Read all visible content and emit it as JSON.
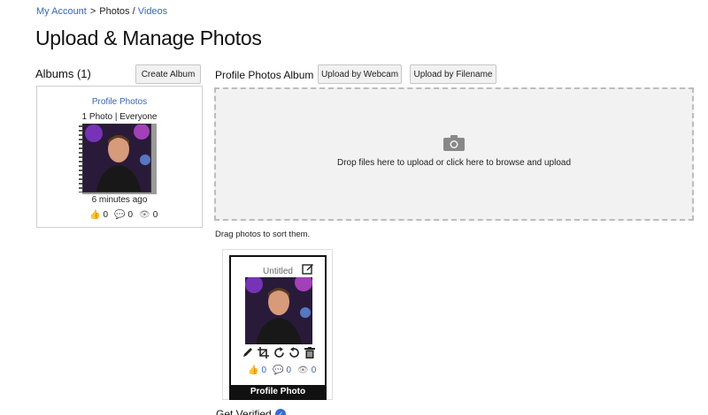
{
  "breadcrumb": {
    "my_account": "My Account",
    "separator": ">",
    "photos": "Photos",
    "slash": "/",
    "videos": "Videos"
  },
  "page": {
    "title": "Upload & Manage Photos"
  },
  "albums": {
    "title": "Albums (1)",
    "create_button": "Create Album",
    "items": [
      {
        "name": "Profile Photos",
        "meta": "1 Photo | Everyone",
        "time": "6 minutes ago",
        "likes": "0",
        "comments": "0",
        "views": "0"
      }
    ]
  },
  "album_view": {
    "title": "Profile Photos Album",
    "webcam_button": "Upload by Webcam",
    "filename_button": "Upload by Filename",
    "dropzone_text": "Drop files here to upload or click here to browse and upload",
    "drag_hint": "Drag photos to sort them."
  },
  "photos": [
    {
      "caption": "Untitled",
      "likes": "0",
      "comments": "0",
      "views": "0",
      "badge": "Profile Photo"
    }
  ],
  "footer": {
    "get_verified": "Get Verified"
  },
  "colors": {
    "link": "#3a66b5",
    "dropzone_bg": "#f2f2f2",
    "badge_bg": "#111111",
    "verified": "#2f6fd6"
  }
}
